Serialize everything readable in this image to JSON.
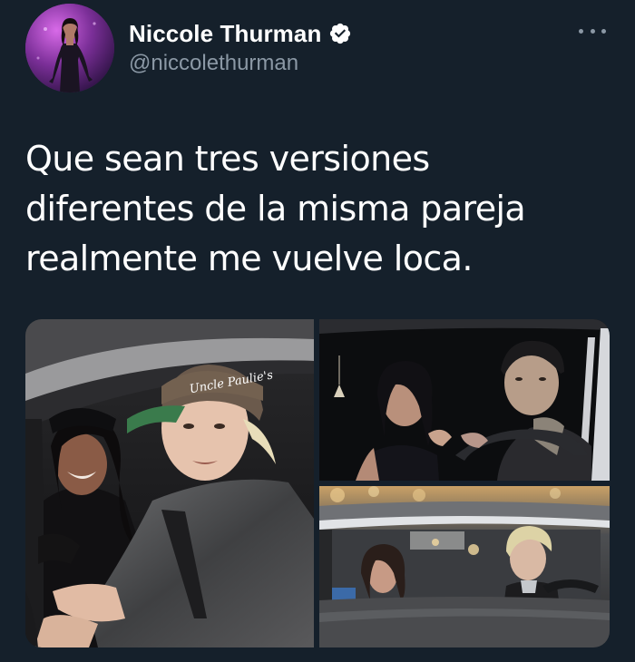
{
  "tweet": {
    "author": {
      "display_name": "Niccole Thurman",
      "handle": "@niccolethurman",
      "verified": true,
      "avatar_icon": "profile-photo"
    },
    "more_icon": "more-horizontal-icon",
    "text": "Que sean tres versiones diferentes de la misma pareja realmente me vuelve loca.",
    "media": [
      {
        "description_icon": "couple-in-car-photo"
      },
      {
        "description_icon": "couple-in-car-photo"
      },
      {
        "description_icon": "couple-in-car-photo"
      }
    ],
    "photo_caption_on_cap": "Uncle Paulie's"
  },
  "colors": {
    "background": "#15202b",
    "text_primary": "#ffffff",
    "text_secondary": "#8b98a5",
    "verified_badge": "#ffffff"
  }
}
